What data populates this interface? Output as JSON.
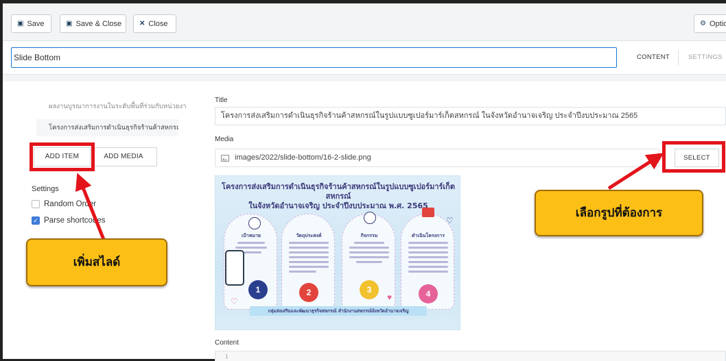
{
  "toolbar": {
    "save_label": "Save",
    "save_close_label": "Save & Close",
    "close_label": "Close",
    "options_label": "Optio"
  },
  "module": {
    "title_value": "Slide Bottom",
    "tabs": [
      {
        "label": "CONTENT",
        "active": true
      },
      {
        "label": "SETTINGS",
        "active": false
      }
    ]
  },
  "sidebar": {
    "items": [
      {
        "label": "ผลงานบูรณาการงานในระดับพื้นที่ร่วมกับหน่วยงา"
      },
      {
        "label": "โครงการส่งเสริมการดำเนินธุรกิจร้านค้าสหกรณ์ใน"
      }
    ],
    "add_item_label": "ADD ITEM",
    "add_media_label": "ADD MEDIA",
    "settings_label": "Settings",
    "random_order_label": "Random Order",
    "random_order_checked": false,
    "parse_shortcodes_label": "Parse shortcodes",
    "parse_shortcodes_checked": true
  },
  "form": {
    "title_label": "Title",
    "title_value": "โครงการส่งเสริมการดำเนินธุรกิจร้านค้าสหกรณ์ในรูปแบบซูเปอร์มาร์เก็ตสหกรณ์ ในจังหวัดอำนาจเจริญ ประจำปีงบประมาณ 2565",
    "media_label": "Media",
    "media_value": "images/2022/slide-bottom/16-2-slide.png",
    "select_label": "SELECT",
    "content_label": "Content",
    "content_line_number": "1"
  },
  "preview": {
    "title_line1": "โครงการส่งเสริมการดำเนินธุรกิจร้านค้าสหกรณ์ในรูปแบบซูเปอร์มาร์เก็ตสหกรณ์",
    "title_line2": "ในจังหวัดอำนาจเจริญ ประจำปีงบประมาณ พ.ศ. 2565",
    "columns": [
      {
        "head": "เป้าหมาย",
        "number": "1",
        "color": "#2b3f8f"
      },
      {
        "head": "วัตถุประสงค์",
        "number": "2",
        "color": "#e2453d"
      },
      {
        "head": "กิจกรรม",
        "number": "3",
        "color": "#f2c12e"
      },
      {
        "head": "ดำเนินโครงการ",
        "number": "4",
        "color": "#e6639a"
      }
    ],
    "bottom_text": "กลุ่มส่งเสริมและพัฒนาธุรกิจสหกรณ์ สำนักงานสหกรณ์จังหวัดอำนาจเจริญ"
  },
  "annotations": {
    "select_callout": "เลือกรูปที่ต้องการ",
    "add_callout": "เพิ่มสไลด์",
    "highlight_color": "#e3141b",
    "callout_color": "#fbbf16"
  }
}
